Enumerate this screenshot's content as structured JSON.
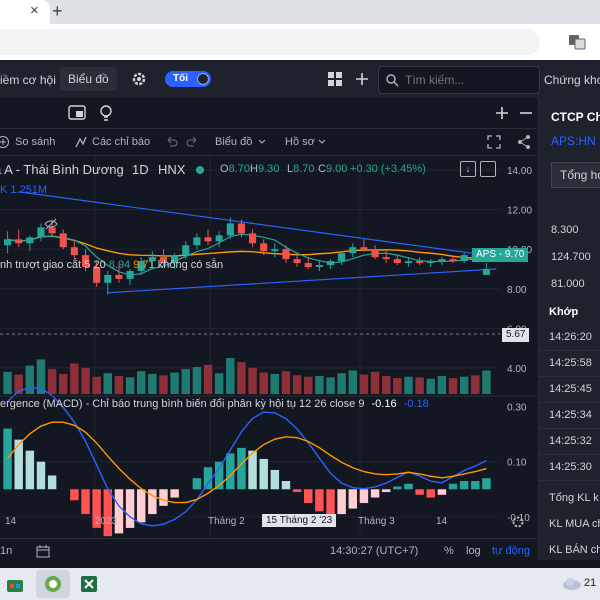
{
  "browser": {
    "close_tab_glyph": "×",
    "new_tab_glyph": "+"
  },
  "header": {
    "opportunities_label": "iềm cơ hội",
    "chart_label": "Biểu đồ",
    "dark_toggle_label": "Tối",
    "search_placeholder": "Tìm kiếm...",
    "right_label": "Chứng khoá"
  },
  "toolbar": {
    "compare_label": "So sánh",
    "indicators_label": "Các chỉ báo",
    "chart_menu_label": "Biểu đồ",
    "profile_menu_label": "Hồ sơ"
  },
  "legend": {
    "symbol_title": "a A - Thái Bình Dương",
    "interval": "1D",
    "exchange": "HNX",
    "open_label": "O",
    "open_value": "8.70",
    "high_label": "H",
    "high_value": "9.30",
    "low_label": "L",
    "low_value": "8.70",
    "close_label": "C",
    "close_value": "9.00",
    "change": "+0.30 (+3.45%)",
    "volume_label": "K 1.251M",
    "ma_label": "nh trượt giao cắt 5 20",
    "ma_val1": "8.94",
    "ma_val2": "9.71",
    "ma_na": "không có sẵn",
    "macd_title": "ergence (MACD) - Chỉ báo trung bình biến đổi phân kỳ hội tụ 12 26 close 9",
    "macd_v1": "-0.16",
    "macd_v2": "-0.18"
  },
  "price_badge": {
    "symbol": "APS",
    "price": "9.70",
    "level": "5.67"
  },
  "price_axis": [
    "14.00",
    "12.00",
    "10.00",
    "8.00",
    "6.00",
    "4.00"
  ],
  "macd_axis": [
    "0.30",
    "0.10",
    "-0.10"
  ],
  "time_axis": [
    "14",
    "2023",
    "Tháng 2",
    "15 Tháng 2 '23",
    "Tháng 3",
    "14"
  ],
  "status": {
    "range_label": "1n",
    "clock": "14:30:27 (UTC+7)",
    "percent_label": "%",
    "log_label": "log",
    "auto_label": "tự động"
  },
  "right_panel": {
    "title": "CTCP Ch",
    "ticker": "APS:HN",
    "summary_button": "Tổng hợ",
    "prices": [
      "8.300",
      "124.700",
      "81.000"
    ],
    "match_header": "Khớp",
    "times": [
      "14:26:20",
      "14:25:58",
      "14:25:45",
      "14:25:34",
      "14:25:32",
      "14:25:30"
    ],
    "totals": [
      "Tổng KL k",
      "KL MUA ch",
      "KL BÁN ch"
    ]
  },
  "taskbar": {
    "weather": "21"
  },
  "chart_data": {
    "type": "candlestick",
    "candles": [
      {
        "o": 10.2,
        "h": 10.9,
        "l": 9.8,
        "c": 10.5
      },
      {
        "o": 10.5,
        "h": 11.0,
        "l": 10.1,
        "c": 10.3
      },
      {
        "o": 10.3,
        "h": 10.7,
        "l": 9.9,
        "c": 10.6
      },
      {
        "o": 10.6,
        "h": 11.3,
        "l": 10.4,
        "c": 11.1
      },
      {
        "o": 11.1,
        "h": 11.5,
        "l": 10.6,
        "c": 10.8
      },
      {
        "o": 10.8,
        "h": 11.0,
        "l": 10.0,
        "c": 10.1
      },
      {
        "o": 10.1,
        "h": 10.4,
        "l": 9.5,
        "c": 9.7
      },
      {
        "o": 9.7,
        "h": 10.0,
        "l": 8.9,
        "c": 9.1
      },
      {
        "o": 9.1,
        "h": 9.4,
        "l": 8.1,
        "c": 8.3
      },
      {
        "o": 8.3,
        "h": 8.9,
        "l": 7.7,
        "c": 8.7
      },
      {
        "o": 8.7,
        "h": 9.2,
        "l": 8.3,
        "c": 8.5
      },
      {
        "o": 8.5,
        "h": 9.0,
        "l": 8.2,
        "c": 8.9
      },
      {
        "o": 8.9,
        "h": 9.6,
        "l": 8.7,
        "c": 9.4
      },
      {
        "o": 9.4,
        "h": 9.9,
        "l": 9.1,
        "c": 9.6
      },
      {
        "o": 9.6,
        "h": 10.0,
        "l": 9.2,
        "c": 9.3
      },
      {
        "o": 9.3,
        "h": 9.8,
        "l": 9.0,
        "c": 9.7
      },
      {
        "o": 9.7,
        "h": 10.4,
        "l": 9.5,
        "c": 10.2
      },
      {
        "o": 10.2,
        "h": 10.8,
        "l": 10.0,
        "c": 10.6
      },
      {
        "o": 10.6,
        "h": 11.0,
        "l": 10.2,
        "c": 10.4
      },
      {
        "o": 10.4,
        "h": 10.9,
        "l": 10.1,
        "c": 10.7
      },
      {
        "o": 10.7,
        "h": 11.6,
        "l": 10.5,
        "c": 11.3
      },
      {
        "o": 11.3,
        "h": 11.5,
        "l": 10.6,
        "c": 10.8
      },
      {
        "o": 10.8,
        "h": 11.0,
        "l": 10.1,
        "c": 10.3
      },
      {
        "o": 10.3,
        "h": 10.5,
        "l": 9.7,
        "c": 9.9
      },
      {
        "o": 9.9,
        "h": 10.3,
        "l": 9.6,
        "c": 10.0
      },
      {
        "o": 10.0,
        "h": 10.2,
        "l": 9.3,
        "c": 9.5
      },
      {
        "o": 9.5,
        "h": 9.8,
        "l": 9.1,
        "c": 9.3
      },
      {
        "o": 9.3,
        "h": 9.6,
        "l": 9.0,
        "c": 9.1
      },
      {
        "o": 9.1,
        "h": 9.4,
        "l": 8.9,
        "c": 9.2
      },
      {
        "o": 9.2,
        "h": 9.5,
        "l": 9.0,
        "c": 9.4
      },
      {
        "o": 9.4,
        "h": 9.9,
        "l": 9.2,
        "c": 9.8
      },
      {
        "o": 9.8,
        "h": 10.3,
        "l": 9.6,
        "c": 10.1
      },
      {
        "o": 10.1,
        "h": 10.5,
        "l": 9.9,
        "c": 10.0
      },
      {
        "o": 10.0,
        "h": 10.2,
        "l": 9.5,
        "c": 9.6
      },
      {
        "o": 9.6,
        "h": 9.9,
        "l": 9.3,
        "c": 9.5
      },
      {
        "o": 9.5,
        "h": 9.7,
        "l": 9.2,
        "c": 9.3
      },
      {
        "o": 9.3,
        "h": 9.6,
        "l": 9.1,
        "c": 9.4
      },
      {
        "o": 9.4,
        "h": 9.6,
        "l": 9.2,
        "c": 9.3
      },
      {
        "o": 9.3,
        "h": 9.5,
        "l": 9.1,
        "c": 9.4
      },
      {
        "o": 9.4,
        "h": 9.6,
        "l": 9.2,
        "c": 9.5
      },
      {
        "o": 9.5,
        "h": 9.7,
        "l": 9.3,
        "c": 9.4
      },
      {
        "o": 9.4,
        "h": 9.8,
        "l": 9.3,
        "c": 9.7
      },
      {
        "o": 9.7,
        "h": 9.9,
        "l": 9.4,
        "c": 9.5
      },
      {
        "o": 8.7,
        "h": 9.3,
        "l": 8.7,
        "c": 9.0
      }
    ],
    "volume": [
      3.2,
      2.8,
      4.1,
      5.0,
      3.6,
      2.9,
      4.4,
      3.8,
      2.5,
      3.0,
      2.6,
      2.4,
      3.3,
      2.9,
      2.7,
      3.1,
      3.6,
      3.9,
      4.2,
      3.0,
      5.2,
      4.6,
      3.8,
      3.1,
      2.9,
      3.3,
      2.7,
      2.5,
      2.6,
      2.4,
      3.0,
      3.4,
      2.8,
      3.2,
      2.6,
      2.3,
      2.5,
      2.4,
      2.2,
      2.6,
      2.3,
      2.5,
      2.7,
      3.4
    ],
    "macd_hist": [
      0.22,
      0.18,
      0.14,
      0.1,
      0.05,
      0.0,
      -0.04,
      -0.09,
      -0.14,
      -0.17,
      -0.16,
      -0.14,
      -0.12,
      -0.09,
      -0.06,
      -0.03,
      0.0,
      0.04,
      0.08,
      0.1,
      0.13,
      0.15,
      0.14,
      0.11,
      0.07,
      0.03,
      -0.01,
      -0.05,
      -0.08,
      -0.1,
      -0.09,
      -0.07,
      -0.05,
      -0.03,
      -0.01,
      0.01,
      0.02,
      -0.02,
      -0.03,
      -0.02,
      0.02,
      0.03,
      0.03,
      0.04
    ],
    "ylim": [
      3,
      15
    ],
    "macd_ylim": [
      -0.26,
      0.32
    ]
  }
}
